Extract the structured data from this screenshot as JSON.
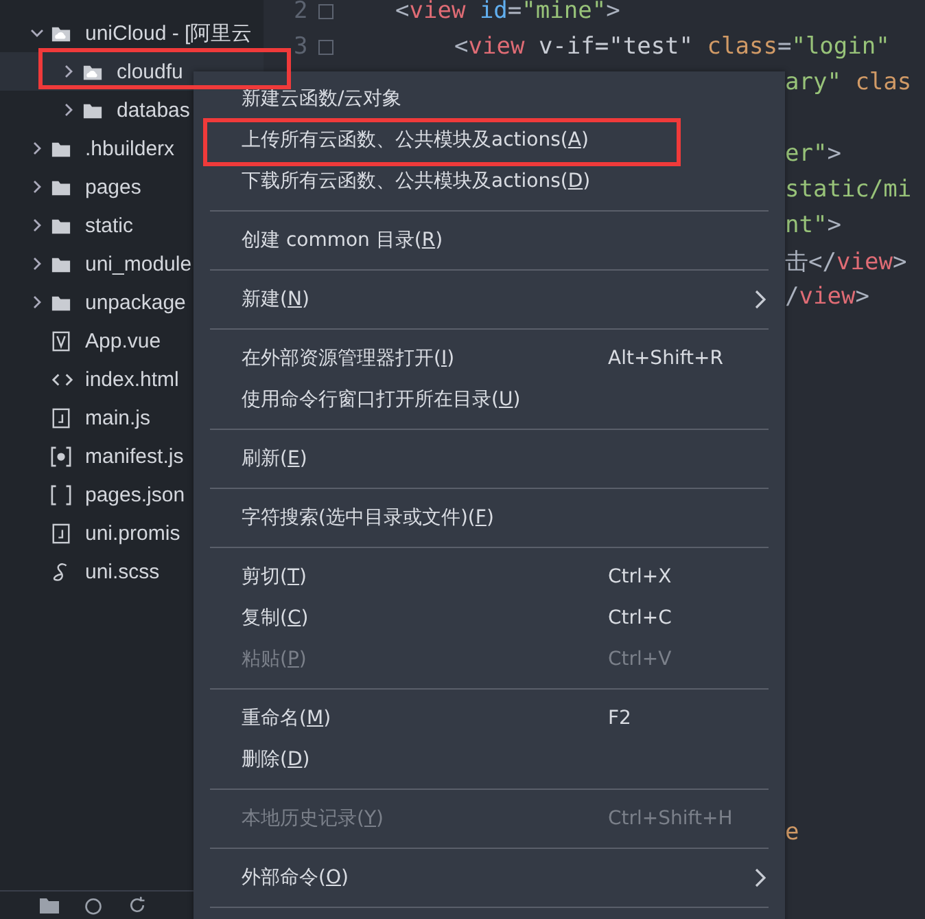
{
  "tree": [
    {
      "label": "uniCloud - [阿里云",
      "kind": "cloud-folder",
      "expanded": true,
      "selected": false,
      "children": [
        {
          "label": "cloudfu",
          "kind": "cloud-folder",
          "expanded": false,
          "selected": true,
          "framed": true
        },
        {
          "label": "databas",
          "kind": "folder",
          "expanded": false,
          "selected": false
        }
      ]
    },
    {
      "label": ".hbuilderx",
      "kind": "folder",
      "expanded": false,
      "selected": false
    },
    {
      "label": "pages",
      "kind": "folder",
      "expanded": false,
      "selected": false
    },
    {
      "label": "static",
      "kind": "folder",
      "expanded": false,
      "selected": false
    },
    {
      "label": "uni_module",
      "kind": "folder",
      "expanded": false,
      "selected": false
    },
    {
      "label": "unpackage",
      "kind": "folder",
      "expanded": false,
      "selected": false
    },
    {
      "label": "App.vue",
      "kind": "vue",
      "selected": false
    },
    {
      "label": "index.html",
      "kind": "html",
      "selected": false
    },
    {
      "label": "main.js",
      "kind": "js",
      "selected": false
    },
    {
      "label": "manifest.js",
      "kind": "settings",
      "selected": false
    },
    {
      "label": "pages.json",
      "kind": "json",
      "selected": false
    },
    {
      "label": "uni.promis",
      "kind": "js",
      "selected": false
    },
    {
      "label": "uni.scss",
      "kind": "scss",
      "selected": false
    }
  ],
  "code_lines": [
    {
      "kind": "outer",
      "number": "2",
      "fold": true,
      "tokens": [
        {
          "text": "<",
          "color": "#abb2bf"
        },
        {
          "text": "view",
          "color": "#e06c75"
        },
        {
          "text": " id",
          "color": "#61afef"
        },
        {
          "text": "=",
          "color": "#abb2bf"
        },
        {
          "text": "\"mine\"",
          "color": "#98c379"
        },
        {
          "text": ">",
          "color": "#abb2bf"
        }
      ]
    },
    {
      "kind": "inner",
      "number": "3",
      "fold": true,
      "tokens": [
        {
          "text": "<",
          "color": "#abb2bf"
        },
        {
          "text": "view",
          "color": "#e06c75"
        },
        {
          "text": " v-if=\"test\"",
          "color": "#c8ccd4"
        },
        {
          "text": " class",
          "color": "#d19a66"
        },
        {
          "text": "=",
          "color": "#abb2bf"
        },
        {
          "text": "\"login\"",
          "color": "#98c379"
        }
      ]
    },
    {
      "kind": "right",
      "tokens": [
        {
          "text": "ary\"",
          "color": "#98c379"
        },
        {
          "text": " clas",
          "color": "#d19a66"
        }
      ]
    },
    {
      "kind": "blank"
    },
    {
      "kind": "right",
      "tokens": [
        {
          "text": "er\"",
          "color": "#98c379"
        },
        {
          "text": ">",
          "color": "#abb2bf"
        }
      ]
    },
    {
      "kind": "right",
      "tokens": [
        {
          "text": "static/mi",
          "color": "#98c379"
        }
      ]
    },
    {
      "kind": "right",
      "tokens": [
        {
          "text": "nt\"",
          "color": "#98c379"
        },
        {
          "text": ">",
          "color": "#abb2bf"
        }
      ]
    },
    {
      "kind": "right",
      "tokens": [
        {
          "text": "击</",
          "color": "#abb2bf"
        },
        {
          "text": "view",
          "color": "#e06c75"
        },
        {
          "text": ">",
          "color": "#abb2bf"
        }
      ]
    },
    {
      "kind": "right",
      "tokens": [
        {
          "text": "/",
          "color": "#abb2bf"
        },
        {
          "text": "view",
          "color": "#e06c75"
        },
        {
          "text": ">",
          "color": "#abb2bf"
        }
      ]
    },
    {
      "kind": "blank"
    },
    {
      "kind": "blank"
    },
    {
      "kind": "blank"
    },
    {
      "kind": "blank"
    },
    {
      "kind": "blank"
    },
    {
      "kind": "blank"
    },
    {
      "kind": "blank"
    },
    {
      "kind": "blank"
    },
    {
      "kind": "blank"
    },
    {
      "kind": "blank"
    },
    {
      "kind": "blank"
    },
    {
      "kind": "blank"
    },
    {
      "kind": "blank"
    },
    {
      "kind": "blank"
    },
    {
      "kind": "right",
      "tokens": [
        {
          "text": "e",
          "color": "#d19a66"
        }
      ]
    }
  ],
  "menu": [
    {
      "kind": "item",
      "before": "新建云函数/云对象",
      "disabled": false,
      "submenu": false
    },
    {
      "kind": "item",
      "before": "上传所有云函数、公共模块及actions(",
      "key": "A",
      "after": ")",
      "disabled": false,
      "submenu": false,
      "framed": true
    },
    {
      "kind": "item",
      "before": "下载所有云函数、公共模块及actions(",
      "key": "D",
      "after": ")",
      "disabled": false,
      "submenu": false
    },
    {
      "kind": "separator"
    },
    {
      "kind": "item",
      "before": "创建 common 目录(",
      "key": "R",
      "after": ")",
      "disabled": false,
      "submenu": false
    },
    {
      "kind": "separator"
    },
    {
      "kind": "item",
      "before": "新建(",
      "key": "N",
      "after": ")",
      "disabled": false,
      "submenu": true
    },
    {
      "kind": "separator"
    },
    {
      "kind": "item",
      "before": "在外部资源管理器打开(",
      "key": "I",
      "after": ")",
      "shortcut": "Alt+Shift+R",
      "disabled": false,
      "submenu": false
    },
    {
      "kind": "item",
      "before": "使用命令行窗口打开所在目录(",
      "key": "U",
      "after": ")",
      "disabled": false,
      "submenu": false
    },
    {
      "kind": "separator"
    },
    {
      "kind": "item",
      "before": "刷新(",
      "key": "E",
      "after": ")",
      "disabled": false,
      "submenu": false
    },
    {
      "kind": "separator"
    },
    {
      "kind": "item",
      "before": "字符搜索(选中目录或文件)(",
      "key": "F",
      "after": ")",
      "disabled": false,
      "submenu": false
    },
    {
      "kind": "separator"
    },
    {
      "kind": "item",
      "before": "剪切(",
      "key": "T",
      "after": ")",
      "shortcut": "Ctrl+X",
      "disabled": false,
      "submenu": false
    },
    {
      "kind": "item",
      "before": "复制(",
      "key": "C",
      "after": ")",
      "shortcut": "Ctrl+C",
      "disabled": false,
      "submenu": false
    },
    {
      "kind": "item",
      "before": "粘贴(",
      "key": "P",
      "after": ")",
      "shortcut": "Ctrl+V",
      "disabled": true,
      "submenu": false
    },
    {
      "kind": "separator"
    },
    {
      "kind": "item",
      "before": "重命名(",
      "key": "M",
      "after": ")",
      "shortcut": "F2",
      "disabled": false,
      "submenu": false
    },
    {
      "kind": "item",
      "before": "删除(",
      "key": "D",
      "after": ")",
      "disabled": false,
      "submenu": false
    },
    {
      "kind": "separator"
    },
    {
      "kind": "item",
      "before": "本地历史记录(",
      "key": "Y",
      "after": ")",
      "shortcut": "Ctrl+Shift+H",
      "disabled": true,
      "submenu": false
    },
    {
      "kind": "separator"
    },
    {
      "kind": "item",
      "before": "外部命令(",
      "key": "O",
      "after": ")",
      "disabled": false,
      "submenu": true
    },
    {
      "kind": "separator"
    }
  ]
}
